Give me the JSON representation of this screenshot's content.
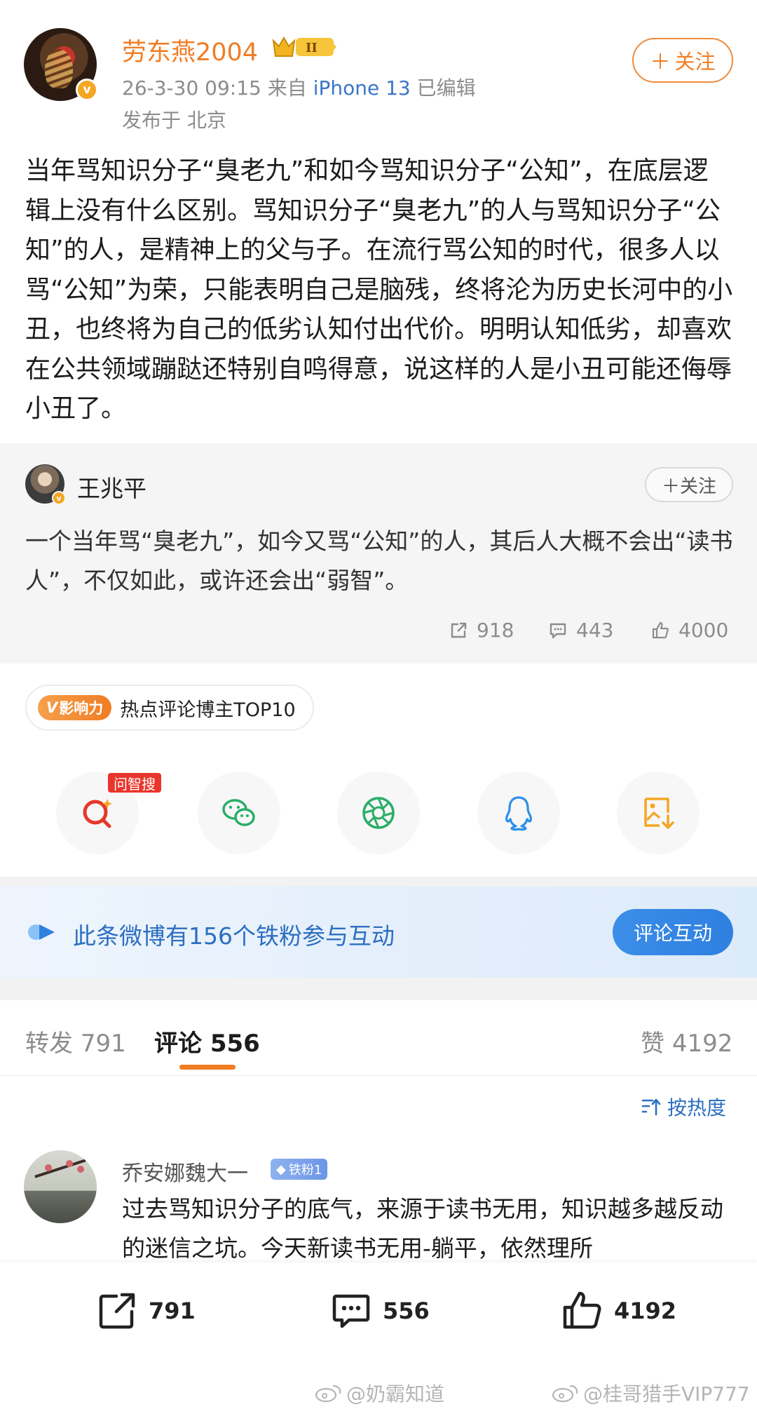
{
  "post": {
    "author": "劳东燕2004",
    "level_badge": "II",
    "timestamp": "26-3-30 09:15",
    "source_prefix": "来自",
    "device": "iPhone 13",
    "edited": "已编辑",
    "location": "发布于 北京",
    "follow_label": "关注",
    "body": "当年骂知识分子“臭老九”和如今骂知识分子“公知”，在底层逻辑上没有什么区别。骂知识分子“臭老九”的人与骂知识分子“公知”的人，是精神上的父与子。在流行骂公知的时代，很多人以骂“公知”为荣，只能表明自己是脑残，终将沦为历史长河中的小丑，也终将为自己的低劣认知付出代价。明明认知低劣，却喜欢在公共领域蹦跶还特别自鸣得意，说这样的人是小丑可能还侮辱小丑了。"
  },
  "repost": {
    "author": "王兆平",
    "follow_label": "关注",
    "text": "一个当年骂“臭老九”，如今又骂“公知”的人，其后人大概不会出“读书人”，不仅如此，或许还会出“弱智”。",
    "shares": "918",
    "comments": "443",
    "likes": "4000"
  },
  "influence": {
    "tag": "影响力",
    "text": "热点评论博主TOP10"
  },
  "share_targets": {
    "ai_search_tag": "问智搜",
    "items": [
      "ai-search",
      "wechat",
      "moments",
      "qq",
      "save-image"
    ]
  },
  "iron_fans": {
    "text": "此条微博有156个铁粉参与互动",
    "button": "评论互动"
  },
  "tabs": {
    "repost_label": "转发",
    "repost_count": "791",
    "comment_label": "评论",
    "comment_count": "556",
    "like_label": "赞",
    "like_count": "4192"
  },
  "sort": {
    "label": "按热度"
  },
  "comments": [
    {
      "author": "乔安娜魏大一",
      "badge": "铁粉1",
      "text": "过去骂知识分子的底气，来源于读书无用，知识越多越反动的迷信之坑。今天新读书无用-躺平，依然理所"
    }
  ],
  "action_bar": {
    "repost": "791",
    "comment": "556",
    "like": "4192"
  },
  "watermarks": {
    "left": "@奶霸知道",
    "right": "@桂哥猎手VIP777"
  },
  "colors": {
    "brand_orange": "#f07d24",
    "link_blue": "#2c6fc0",
    "ai_red": "#e8362c"
  }
}
